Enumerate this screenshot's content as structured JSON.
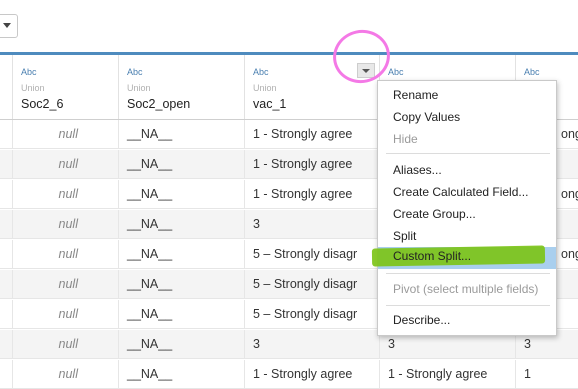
{
  "columns": [
    {
      "type": "Abc",
      "source": "Union",
      "name": "Soc2_6"
    },
    {
      "type": "Abc",
      "source": "Union",
      "name": "Soc2_open"
    },
    {
      "type": "Abc",
      "source": "Union",
      "name": "vac_1"
    },
    {
      "type": "Abc",
      "source": "",
      "name": ""
    },
    {
      "type": "Abc",
      "source": "",
      "name": ""
    }
  ],
  "rows": [
    [
      "",
      "null",
      "__NA__",
      "1 - Strongly agree",
      "",
      "ong"
    ],
    [
      "",
      "null",
      "__NA__",
      "1 - Strongly agree",
      "",
      ""
    ],
    [
      "",
      "null",
      "__NA__",
      "1 - Strongly agree",
      "",
      "ong"
    ],
    [
      "",
      "null",
      "__NA__",
      "3",
      "",
      ""
    ],
    [
      "",
      "null",
      "__NA__",
      "5 – Strongly disagr",
      "",
      "ong"
    ],
    [
      "",
      "null",
      "__NA__",
      "5 – Strongly disagr",
      "",
      ""
    ],
    [
      "",
      "null",
      "__NA__",
      "5 – Strongly disagr",
      "",
      ""
    ],
    [
      "",
      "null",
      "__NA__",
      "3",
      "3",
      "3"
    ],
    [
      "",
      "null",
      "__NA__",
      "1 - Strongly agree",
      "1 - Strongly agree",
      "1"
    ]
  ],
  "context_menu": {
    "items": [
      {
        "label": "Rename",
        "disabled": false
      },
      {
        "label": "Copy Values",
        "disabled": false
      },
      {
        "label": "Hide",
        "disabled": true
      },
      {
        "label": "Aliases...",
        "disabled": false
      },
      {
        "label": "Create Calculated Field...",
        "disabled": false
      },
      {
        "label": "Create Group...",
        "disabled": false
      },
      {
        "label": "Split",
        "disabled": false
      },
      {
        "label": "Custom Split...",
        "disabled": false,
        "highlighted": true
      },
      {
        "label": "Pivot (select multiple fields)",
        "disabled": true
      },
      {
        "label": "Describe...",
        "disabled": false
      }
    ]
  },
  "colors": {
    "accent_blue": "#4e8bbe",
    "annotation_circle": "#f479e6",
    "annotation_highlight": "#7dc418",
    "menu_selection": "#a9cfee"
  }
}
